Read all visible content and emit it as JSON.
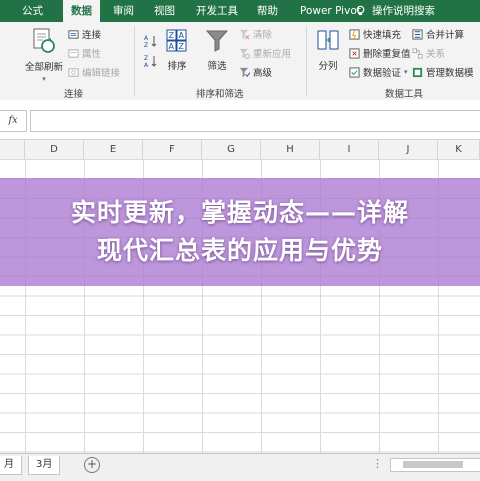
{
  "ribbon_tabs": [
    "公式",
    "数据",
    "审阅",
    "视图",
    "开发工具",
    "帮助",
    "Power Pivot",
    "操作说明搜索"
  ],
  "active_tab": "数据",
  "query_group": {
    "refresh_all": "全部刷新",
    "connections": "连接",
    "properties": "属性",
    "edit_links": "编辑链接",
    "group_label": "连接"
  },
  "sort_filter_group": {
    "sort": "排序",
    "filter": "筛选",
    "clear": "清除",
    "reapply": "重新应用",
    "advanced": "高级",
    "group_label": "排序和筛选"
  },
  "data_tools_group": {
    "text_to_columns": "分列",
    "flash_fill": "快速填充",
    "remove_duplicates": "删除重复值",
    "data_validation": "数据验证",
    "consolidate": "合并计算",
    "relationships": "关系",
    "manage_data_model": "管理数据模",
    "group_label": "数据工具"
  },
  "formula_bar": {
    "fx_label": "fx",
    "value": ""
  },
  "columns": [
    "D",
    "E",
    "F",
    "G",
    "H",
    "I",
    "J",
    "K"
  ],
  "overlay": {
    "line1": "实时更新，掌握动态——详解",
    "line2": "现代汇总表的应用与优势"
  },
  "sheet_tabs": [
    "月",
    "3月"
  ],
  "colors": {
    "excel_green": "#217346",
    "ribbon_bg": "#f3f3f3",
    "overlay_purple": "#aa78d2",
    "grid_line": "#dadada"
  },
  "icons": [
    "refresh-icon",
    "connections-icon",
    "properties-icon",
    "edit-links-icon",
    "sort-az-icon",
    "sort-za-icon",
    "sort-icon",
    "filter-icon",
    "clear-icon",
    "reapply-icon",
    "advanced-icon",
    "text-to-columns-icon",
    "flash-fill-icon",
    "remove-duplicates-icon",
    "data-validation-icon",
    "consolidate-icon",
    "relationships-icon",
    "manage-data-model-icon",
    "lightbulb-icon",
    "add-sheet-icon"
  ]
}
